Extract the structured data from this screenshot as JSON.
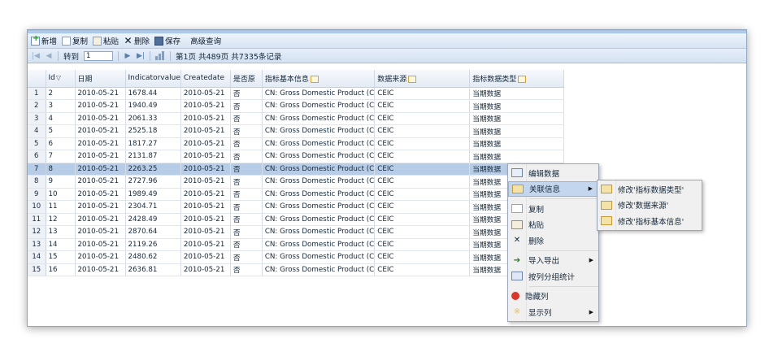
{
  "toolbar": {
    "add": "新增",
    "copy": "复制",
    "paste": "粘贴",
    "delete": "删除",
    "save": "保存",
    "advanced_query": "高级查询"
  },
  "pager": {
    "goto_label": "转到",
    "page_input": "1",
    "page_info": "第1页 共489页 共7335条记录"
  },
  "grid": {
    "headers": [
      "",
      "Id",
      "日期",
      "Indicatorvalue",
      "Createdate",
      "是否原",
      "指标基本信息",
      "数据来源",
      "指标数据类型"
    ],
    "rows": [
      [
        "1",
        "2",
        "2010-05-21",
        "1678.44",
        "2010-05-21",
        "否",
        "CN: Gross Domestic Product (C",
        "CEIC",
        "当期数据"
      ],
      [
        "2",
        "3",
        "2010-05-21",
        "1940.49",
        "2010-05-21",
        "否",
        "CN: Gross Domestic Product (C",
        "CEIC",
        "当期数据"
      ],
      [
        "3",
        "4",
        "2010-05-21",
        "2061.33",
        "2010-05-21",
        "否",
        "CN: Gross Domestic Product (C",
        "CEIC",
        "当期数据"
      ],
      [
        "4",
        "5",
        "2010-05-21",
        "2525.18",
        "2010-05-21",
        "否",
        "CN: Gross Domestic Product (C",
        "CEIC",
        "当期数据"
      ],
      [
        "5",
        "6",
        "2010-05-21",
        "1817.27",
        "2010-05-21",
        "否",
        "CN: Gross Domestic Product (C",
        "CEIC",
        "当期数据"
      ],
      [
        "6",
        "7",
        "2010-05-21",
        "2131.87",
        "2010-05-21",
        "否",
        "CN: Gross Domestic Product (C",
        "CEIC",
        "当期数据"
      ],
      [
        "7",
        "8",
        "2010-05-21",
        "2263.25",
        "2010-05-21",
        "否",
        "CN: Gross Domestic Product (C",
        "CEIC",
        "当期数据"
      ],
      [
        "8",
        "9",
        "2010-05-21",
        "2727.96",
        "2010-05-21",
        "否",
        "CN: Gross Domestic Product (C",
        "CEIC",
        "当期数据"
      ],
      [
        "9",
        "10",
        "2010-05-21",
        "1989.49",
        "2010-05-21",
        "否",
        "CN: Gross Domestic Product (C",
        "CEIC",
        "当期数据"
      ],
      [
        "10",
        "11",
        "2010-05-21",
        "2304.71",
        "2010-05-21",
        "否",
        "CN: Gross Domestic Product (C",
        "CEIC",
        "当期数据"
      ],
      [
        "11",
        "12",
        "2010-05-21",
        "2428.49",
        "2010-05-21",
        "否",
        "CN: Gross Domestic Product (C",
        "CEIC",
        "当期数据"
      ],
      [
        "12",
        "13",
        "2010-05-21",
        "2870.64",
        "2010-05-21",
        "否",
        "CN: Gross Domestic Product (C",
        "CEIC",
        "当期数据"
      ],
      [
        "13",
        "14",
        "2010-05-21",
        "2119.26",
        "2010-05-21",
        "否",
        "CN: Gross Domestic Product (C",
        "CEIC",
        "当期数据"
      ],
      [
        "14",
        "15",
        "2010-05-21",
        "2480.62",
        "2010-05-21",
        "否",
        "CN: Gross Domestic Product (C",
        "CEIC",
        "当期数据"
      ],
      [
        "15",
        "16",
        "2010-05-21",
        "2636.81",
        "2010-05-21",
        "否",
        "CN: Gross Domestic Product (C",
        "CEIC",
        "当期数据"
      ]
    ],
    "selected_row": 7
  },
  "context_menu": {
    "items": [
      {
        "label": "编辑数据",
        "icon": "edit-icon"
      },
      {
        "label": "关联信息",
        "icon": "link-icon",
        "submenu": true
      },
      {
        "label": "复制",
        "icon": "copy-icon"
      },
      {
        "label": "粘贴",
        "icon": "paste-icon"
      },
      {
        "label": "删除",
        "icon": "delete-icon"
      },
      {
        "label": "导入导出",
        "icon": "import-export-icon",
        "submenu": true
      },
      {
        "label": "按列分组统计",
        "icon": "group-stats-icon"
      },
      {
        "label": "隐藏列",
        "icon": "hide-column-icon"
      },
      {
        "label": "显示列",
        "icon": "show-column-icon",
        "submenu": true
      }
    ]
  },
  "submenu": {
    "items": [
      {
        "label": "修改'指标数据类型'"
      },
      {
        "label": "修改'数据来源'"
      },
      {
        "label": "修改'指标基本信息'"
      }
    ]
  },
  "colors": {
    "header_bg": "#d7e4f3",
    "selected_row": "#b7cde7",
    "menu_hover": "#c3d6ee"
  }
}
